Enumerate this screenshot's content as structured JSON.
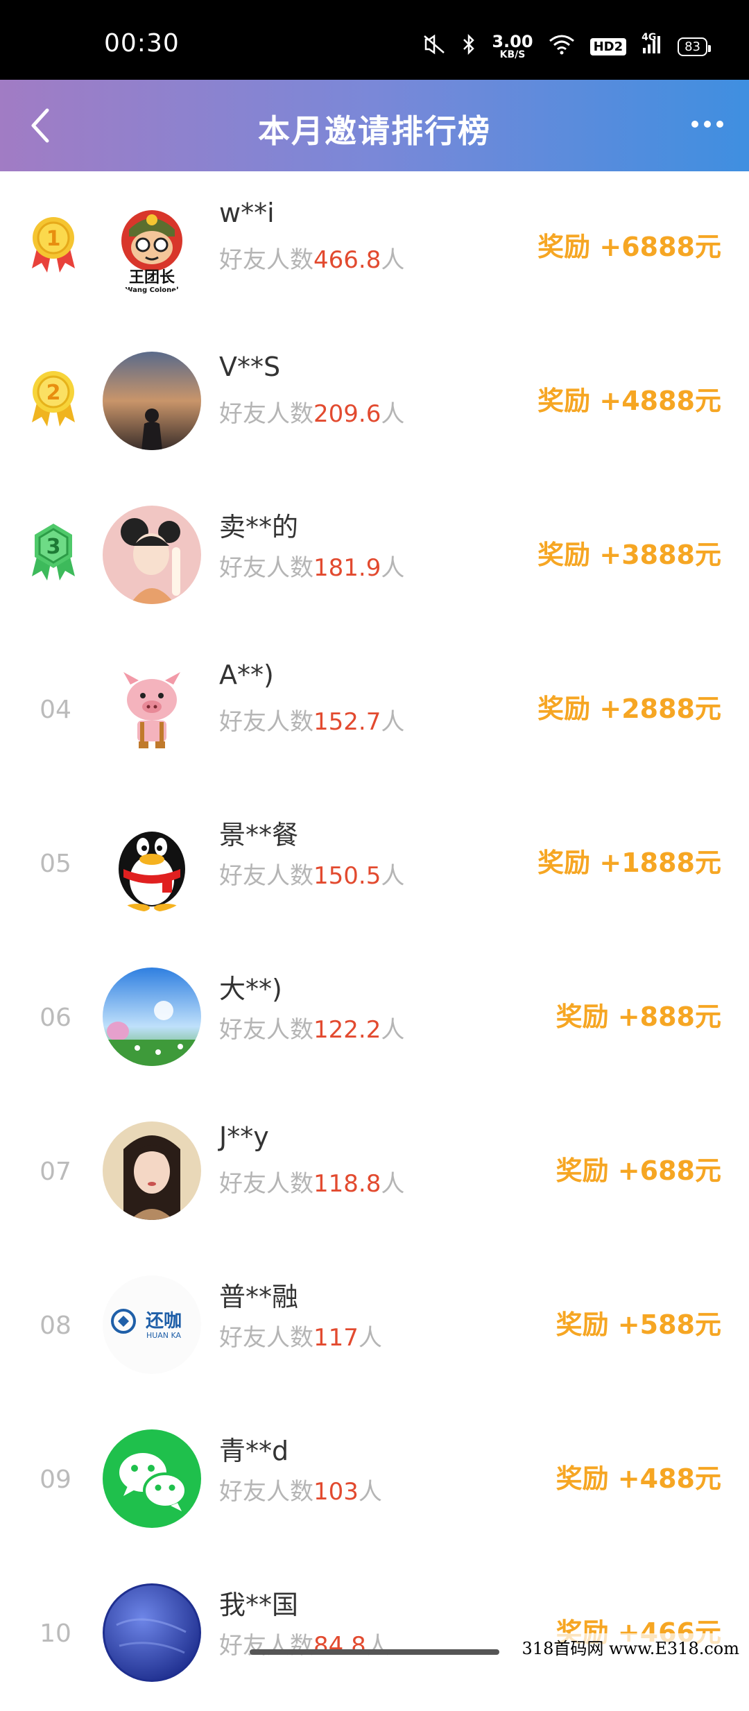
{
  "status_bar": {
    "time": "00:30",
    "speed_value": "3.00",
    "speed_unit": "KB/S",
    "hd_label": "HD2",
    "network": "4G",
    "battery": "83"
  },
  "header": {
    "title": "本月邀请排行榜",
    "gradient": [
      "#a17cc4",
      "#3f8fe0"
    ]
  },
  "count_prefix": "好友人数",
  "count_suffix": "人",
  "reward_prefix": "奖励 +",
  "reward_suffix": "元",
  "colors": {
    "reward": "#f6a623",
    "count_number": "#e24a2f",
    "rank_number": "#bbbbbb"
  },
  "rankings": [
    {
      "rank": "1",
      "medal": "gold",
      "name": "w**i",
      "count": "466.8",
      "reward": "6888",
      "avatar": "soldier-cartoon",
      "avatar_text": [
        "王团长",
        "Wang Colonel"
      ]
    },
    {
      "rank": "2",
      "medal": "gold",
      "name": "V**S",
      "count": "209.6",
      "reward": "4888",
      "avatar": "sunset-silhouette"
    },
    {
      "rank": "3",
      "medal": "green",
      "name": "卖**的",
      "count": "181.9",
      "reward": "3888",
      "avatar": "girl-illustration"
    },
    {
      "rank": "04",
      "name": "A**)",
      "count": "152.7",
      "reward": "2888",
      "avatar": "pig-cartoon"
    },
    {
      "rank": "05",
      "name": "景**餐",
      "count": "150.5",
      "reward": "1888",
      "avatar": "qq-penguin"
    },
    {
      "rank": "06",
      "name": "大**)",
      "count": "122.2",
      "reward": "888",
      "avatar": "blue-sky-landscape"
    },
    {
      "rank": "07",
      "name": "J**y",
      "count": "118.8",
      "reward": "688",
      "avatar": "woman-portrait"
    },
    {
      "rank": "08",
      "name": "普**融",
      "count": "117",
      "reward": "588",
      "avatar": "huanka-logo",
      "avatar_text": [
        "还咖",
        "HUAN KA"
      ]
    },
    {
      "rank": "09",
      "name": "青**d",
      "count": "103",
      "reward": "488",
      "avatar": "wechat-logo"
    },
    {
      "rank": "10",
      "name": "我**国",
      "count": "84.8",
      "reward": "466",
      "avatar": "blue-planet"
    }
  ],
  "watermark": "318首码网 www.E318.com"
}
